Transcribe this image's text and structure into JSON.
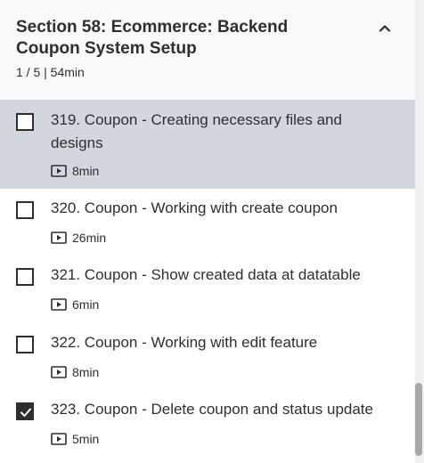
{
  "section": {
    "title": "Section 58: Ecommerce: Backend Coupon System Setup",
    "meta": "1 / 5 | 54min",
    "expanded": true
  },
  "items": [
    {
      "title": "319. Coupon - Creating necessary files and designs",
      "duration": "8min",
      "checked": false,
      "active": true
    },
    {
      "title": "320. Coupon - Working with create coupon",
      "duration": "26min",
      "checked": false,
      "active": false
    },
    {
      "title": "321. Coupon - Show created data at datatable",
      "duration": "6min",
      "checked": false,
      "active": false
    },
    {
      "title": "322. Coupon - Working with edit feature",
      "duration": "8min",
      "checked": false,
      "active": false
    },
    {
      "title": "323. Coupon - Delete coupon and status update",
      "duration": "5min",
      "checked": true,
      "active": false
    }
  ],
  "icons": {
    "collapse": "chevron-up-icon",
    "duration": "video-play-icon",
    "check": "check-icon"
  }
}
